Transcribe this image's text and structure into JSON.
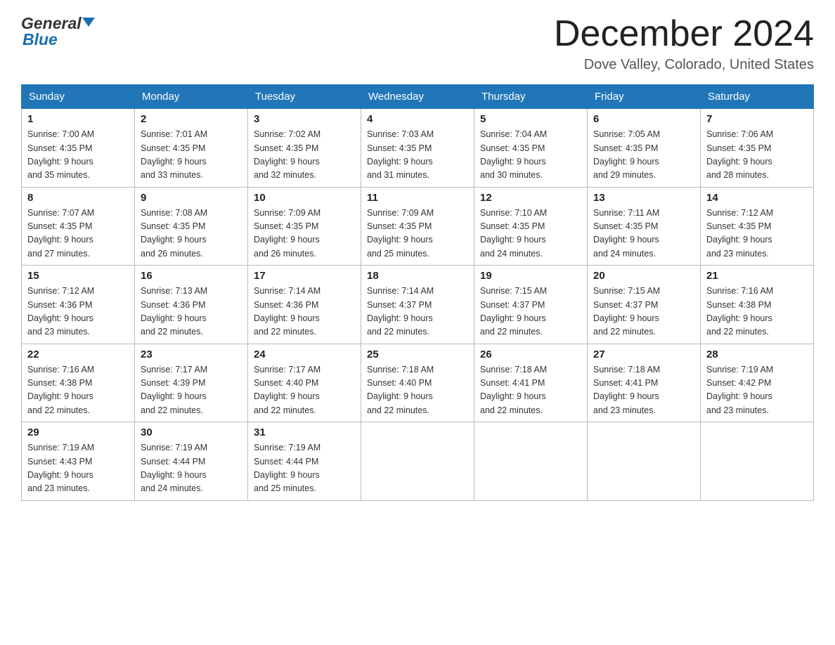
{
  "header": {
    "month_title": "December 2024",
    "location": "Dove Valley, Colorado, United States",
    "logo_general": "General",
    "logo_blue": "Blue"
  },
  "weekdays": [
    "Sunday",
    "Monday",
    "Tuesday",
    "Wednesday",
    "Thursday",
    "Friday",
    "Saturday"
  ],
  "weeks": [
    [
      {
        "day": "1",
        "sunrise": "7:00 AM",
        "sunset": "4:35 PM",
        "daylight": "9 hours and 35 minutes."
      },
      {
        "day": "2",
        "sunrise": "7:01 AM",
        "sunset": "4:35 PM",
        "daylight": "9 hours and 33 minutes."
      },
      {
        "day": "3",
        "sunrise": "7:02 AM",
        "sunset": "4:35 PM",
        "daylight": "9 hours and 32 minutes."
      },
      {
        "day": "4",
        "sunrise": "7:03 AM",
        "sunset": "4:35 PM",
        "daylight": "9 hours and 31 minutes."
      },
      {
        "day": "5",
        "sunrise": "7:04 AM",
        "sunset": "4:35 PM",
        "daylight": "9 hours and 30 minutes."
      },
      {
        "day": "6",
        "sunrise": "7:05 AM",
        "sunset": "4:35 PM",
        "daylight": "9 hours and 29 minutes."
      },
      {
        "day": "7",
        "sunrise": "7:06 AM",
        "sunset": "4:35 PM",
        "daylight": "9 hours and 28 minutes."
      }
    ],
    [
      {
        "day": "8",
        "sunrise": "7:07 AM",
        "sunset": "4:35 PM",
        "daylight": "9 hours and 27 minutes."
      },
      {
        "day": "9",
        "sunrise": "7:08 AM",
        "sunset": "4:35 PM",
        "daylight": "9 hours and 26 minutes."
      },
      {
        "day": "10",
        "sunrise": "7:09 AM",
        "sunset": "4:35 PM",
        "daylight": "9 hours and 26 minutes."
      },
      {
        "day": "11",
        "sunrise": "7:09 AM",
        "sunset": "4:35 PM",
        "daylight": "9 hours and 25 minutes."
      },
      {
        "day": "12",
        "sunrise": "7:10 AM",
        "sunset": "4:35 PM",
        "daylight": "9 hours and 24 minutes."
      },
      {
        "day": "13",
        "sunrise": "7:11 AM",
        "sunset": "4:35 PM",
        "daylight": "9 hours and 24 minutes."
      },
      {
        "day": "14",
        "sunrise": "7:12 AM",
        "sunset": "4:35 PM",
        "daylight": "9 hours and 23 minutes."
      }
    ],
    [
      {
        "day": "15",
        "sunrise": "7:12 AM",
        "sunset": "4:36 PM",
        "daylight": "9 hours and 23 minutes."
      },
      {
        "day": "16",
        "sunrise": "7:13 AM",
        "sunset": "4:36 PM",
        "daylight": "9 hours and 22 minutes."
      },
      {
        "day": "17",
        "sunrise": "7:14 AM",
        "sunset": "4:36 PM",
        "daylight": "9 hours and 22 minutes."
      },
      {
        "day": "18",
        "sunrise": "7:14 AM",
        "sunset": "4:37 PM",
        "daylight": "9 hours and 22 minutes."
      },
      {
        "day": "19",
        "sunrise": "7:15 AM",
        "sunset": "4:37 PM",
        "daylight": "9 hours and 22 minutes."
      },
      {
        "day": "20",
        "sunrise": "7:15 AM",
        "sunset": "4:37 PM",
        "daylight": "9 hours and 22 minutes."
      },
      {
        "day": "21",
        "sunrise": "7:16 AM",
        "sunset": "4:38 PM",
        "daylight": "9 hours and 22 minutes."
      }
    ],
    [
      {
        "day": "22",
        "sunrise": "7:16 AM",
        "sunset": "4:38 PM",
        "daylight": "9 hours and 22 minutes."
      },
      {
        "day": "23",
        "sunrise": "7:17 AM",
        "sunset": "4:39 PM",
        "daylight": "9 hours and 22 minutes."
      },
      {
        "day": "24",
        "sunrise": "7:17 AM",
        "sunset": "4:40 PM",
        "daylight": "9 hours and 22 minutes."
      },
      {
        "day": "25",
        "sunrise": "7:18 AM",
        "sunset": "4:40 PM",
        "daylight": "9 hours and 22 minutes."
      },
      {
        "day": "26",
        "sunrise": "7:18 AM",
        "sunset": "4:41 PM",
        "daylight": "9 hours and 22 minutes."
      },
      {
        "day": "27",
        "sunrise": "7:18 AM",
        "sunset": "4:41 PM",
        "daylight": "9 hours and 23 minutes."
      },
      {
        "day": "28",
        "sunrise": "7:19 AM",
        "sunset": "4:42 PM",
        "daylight": "9 hours and 23 minutes."
      }
    ],
    [
      {
        "day": "29",
        "sunrise": "7:19 AM",
        "sunset": "4:43 PM",
        "daylight": "9 hours and 23 minutes."
      },
      {
        "day": "30",
        "sunrise": "7:19 AM",
        "sunset": "4:44 PM",
        "daylight": "9 hours and 24 minutes."
      },
      {
        "day": "31",
        "sunrise": "7:19 AM",
        "sunset": "4:44 PM",
        "daylight": "9 hours and 25 minutes."
      },
      null,
      null,
      null,
      null
    ]
  ],
  "colors": {
    "header_bg": "#2176b8",
    "header_text": "#ffffff",
    "accent": "#1a6faf"
  }
}
